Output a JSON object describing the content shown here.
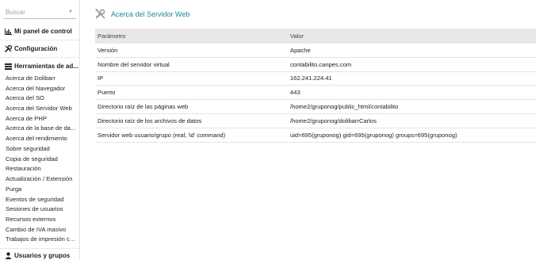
{
  "sidebar": {
    "search": {
      "placeholder": "Buscar",
      "value": ""
    },
    "sections": {
      "dashboard": "Mi panel de control",
      "config": "Configuración",
      "tools": "Herramientas de ad...",
      "users": "Usuarios y grupos"
    },
    "items": [
      "Acerca de Dolibarr",
      "Acerca del Navegador",
      "Acerca del SO",
      "Acerca del Servidor Web",
      "Acerca de PHP",
      "Acerca de la base de datos",
      "Acerca del rendimiento",
      "Sobre seguridad",
      "Copia de seguridad",
      "Restauración",
      "Actualización / Extensión",
      "Purga",
      "Eventos de seguridad",
      "Sesiones de usuarios",
      "Recursos externos",
      "Cambio de IVA masivo",
      "Trabajos de impresión co..."
    ]
  },
  "main": {
    "title": "Acerca del Servidor Web",
    "title_color": "#1a8a8f",
    "icon": "tools-icon",
    "table": {
      "headers": [
        "Parámetro",
        "Valor"
      ],
      "rows": [
        [
          "Versión",
          "Apache"
        ],
        [
          "Nombre del servidor virtual",
          "contabilito.canpes.com"
        ],
        [
          "IP",
          "162.241.224.41"
        ],
        [
          "Puerto",
          "443"
        ],
        [
          "Directorio raíz de las páginas web",
          "/home2/gruponog/public_html/contabilito"
        ],
        [
          "Directorio raíz de los archivos de datos",
          "/home2/gruponog/dolibarrCarlos"
        ],
        [
          "Servidor web usuario/grupo (real, 'id' command)",
          "uid=695(gruponog) gid=695(gruponog) groups=695(gruponog)"
        ]
      ]
    }
  }
}
